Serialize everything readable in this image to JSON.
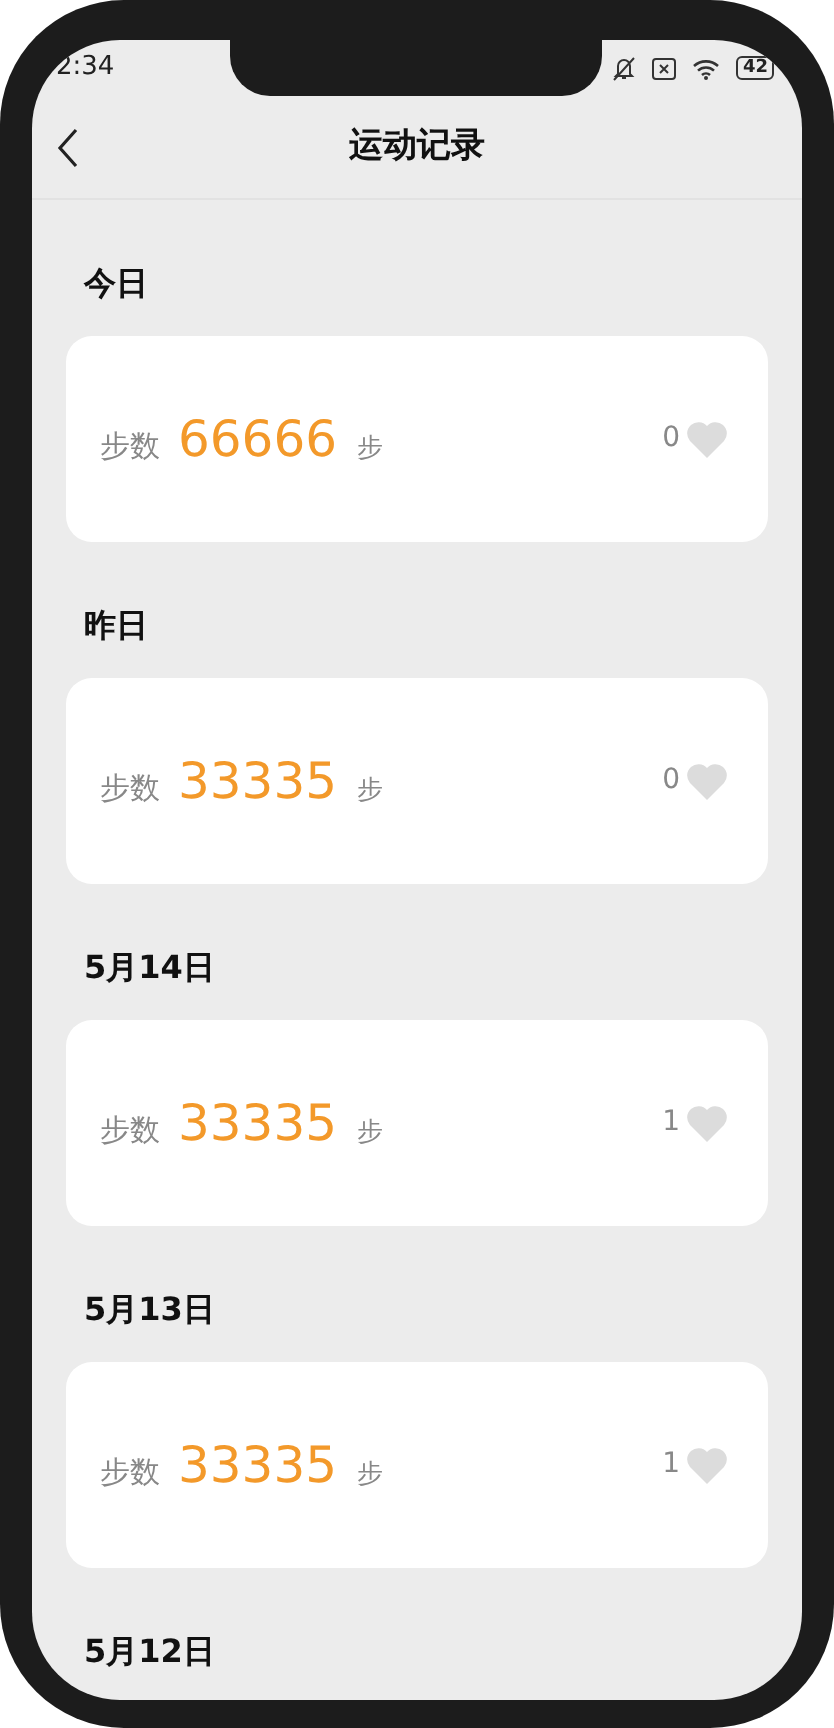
{
  "status_bar": {
    "time": "2:34",
    "battery": "42"
  },
  "header": {
    "title": "运动记录"
  },
  "sections": [
    {
      "label": "今日",
      "record": {
        "steps_label": "步数",
        "steps": "66666",
        "unit": "步",
        "likes": "0"
      }
    },
    {
      "label": "昨日",
      "record": {
        "steps_label": "步数",
        "steps": "33335",
        "unit": "步",
        "likes": "0"
      }
    },
    {
      "label": "5月14日",
      "record": {
        "steps_label": "步数",
        "steps": "33335",
        "unit": "步",
        "likes": "1"
      }
    },
    {
      "label": "5月13日",
      "record": {
        "steps_label": "步数",
        "steps": "33335",
        "unit": "步",
        "likes": "1"
      }
    },
    {
      "label": "5月12日"
    }
  ]
}
